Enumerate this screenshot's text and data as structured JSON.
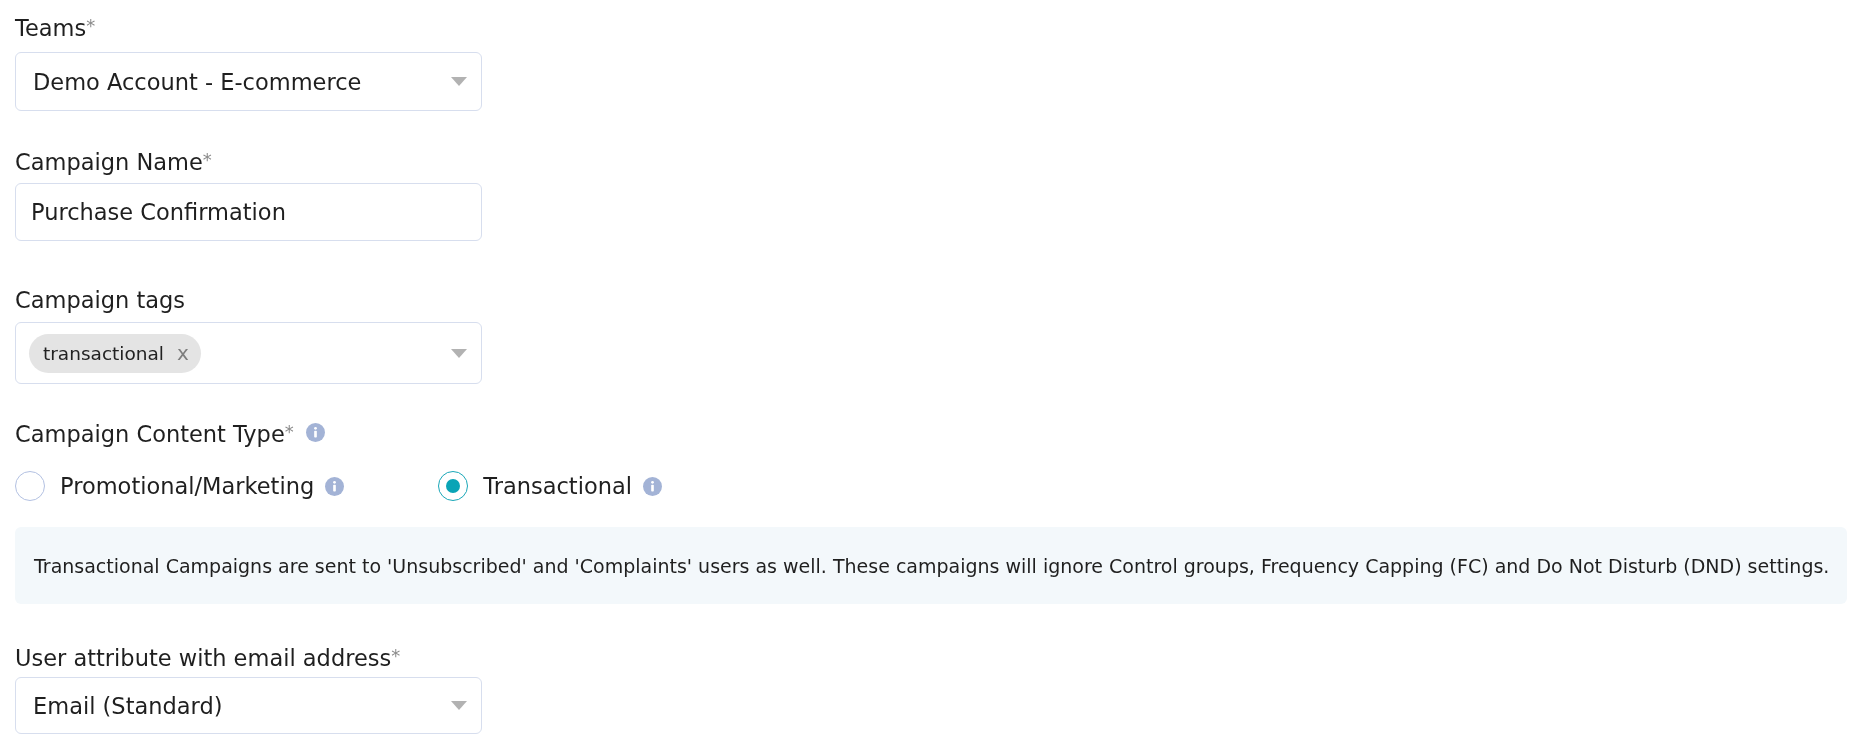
{
  "teams": {
    "label": "Teams$^{*}$",
    "value": "Demo Account - E-commerce"
  },
  "campaign_name": {
    "label": "Campaign Name$^{*}$",
    "value": "Purchase Confirmation"
  },
  "campaign_tags": {
    "label": "Campaign tags",
    "tags": [
      {
        "text": "transactional",
        "remove": "x"
      }
    ]
  },
  "content_type": {
    "label": "Campaign Content Type$^{*}$",
    "options": [
      {
        "label": "Promotional/Marketing",
        "selected": false
      },
      {
        "label": "Transactional",
        "selected": true
      }
    ]
  },
  "notice": "Transactional Campaigns are sent to 'Unsubscribed' and 'Complaints' users as well. These campaigns will ignore Control groups, Frequency Capping (FC) and Do Not Disturb (DND) settings.",
  "email_attribute": {
    "label": "User attribute with email address$^{*}$",
    "value": "Email (Standard)"
  }
}
